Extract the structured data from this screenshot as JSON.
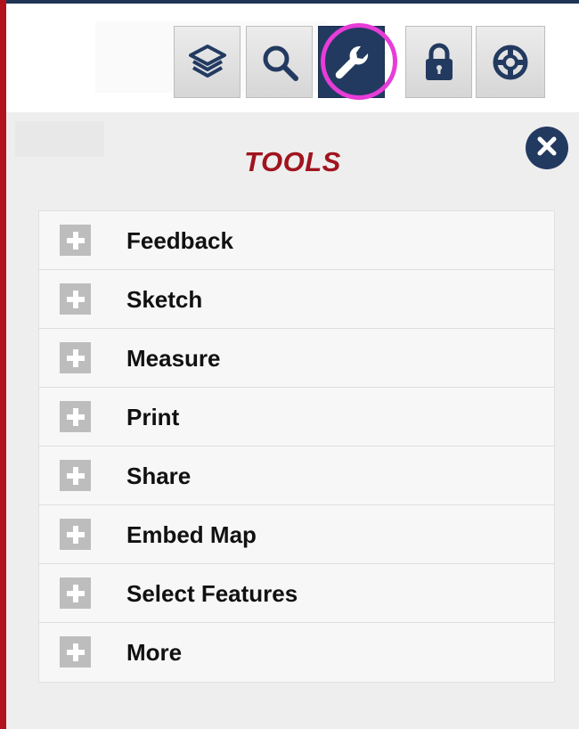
{
  "toolbar": {
    "buttons": [
      {
        "icon": "layers-icon",
        "active": false
      },
      {
        "icon": "search-icon",
        "active": false
      },
      {
        "icon": "wrench-icon",
        "active": true
      },
      {
        "icon": "lock-icon",
        "active": false
      },
      {
        "icon": "lifebuoy-icon",
        "active": false
      }
    ],
    "highlight_color": "#e83cd8",
    "active_color": "#233a60"
  },
  "panel": {
    "title": "TOOLS",
    "title_color": "#a0141e",
    "close_icon": "close-icon",
    "items": [
      {
        "label": "Feedback",
        "icon": "plus-icon"
      },
      {
        "label": "Sketch",
        "icon": "plus-icon"
      },
      {
        "label": "Measure",
        "icon": "plus-icon"
      },
      {
        "label": "Print",
        "icon": "plus-icon"
      },
      {
        "label": "Share",
        "icon": "plus-icon"
      },
      {
        "label": "Embed Map",
        "icon": "plus-icon"
      },
      {
        "label": "Select Features",
        "icon": "plus-icon"
      },
      {
        "label": "More",
        "icon": "plus-icon"
      }
    ]
  }
}
